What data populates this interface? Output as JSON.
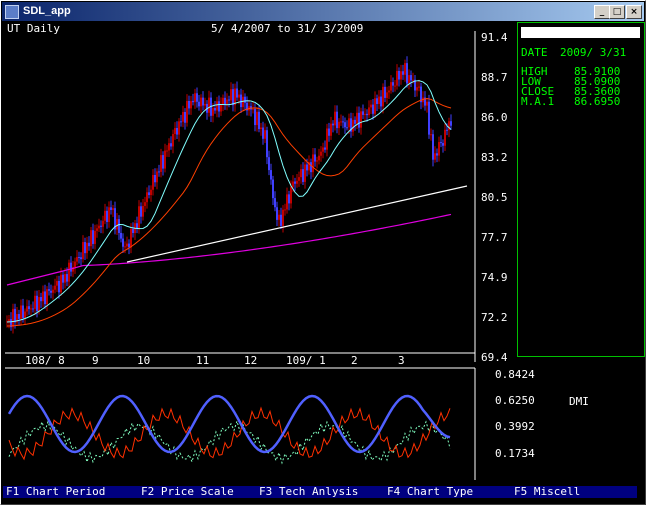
{
  "window": {
    "title": "SDL_app",
    "minimize_label": "_",
    "maximize_label": "□",
    "close_label": "×"
  },
  "chart_header": {
    "left": "UT Daily",
    "period": "5/ 4/2007 to 31/ 3/2009"
  },
  "price_axis": [
    "91.4",
    "88.7",
    "86.0",
    "83.2",
    "80.5",
    "77.7",
    "74.9",
    "72.2",
    "69.4"
  ],
  "date_axis": [
    "108/ 8",
    "9",
    "10",
    "11",
    "12",
    "109/ 1",
    "2",
    "3"
  ],
  "info_panel": {
    "date_label": "DATE",
    "date_value": "2009/ 3/31",
    "rows": [
      {
        "label": "HIGH",
        "value": "85.9100"
      },
      {
        "label": "LOW",
        "value": "85.0900"
      },
      {
        "label": "CLOSE",
        "value": "85.3600"
      },
      {
        "label": "M.A.1",
        "value": "86.6950"
      }
    ]
  },
  "indicator": {
    "name": "DMI",
    "axis": [
      "0.8424",
      "0.6250",
      "0.3992",
      "0.1734"
    ]
  },
  "function_keys": [
    {
      "label": "F1 Chart Period"
    },
    {
      "label": "F2 Price Scale"
    },
    {
      "label": "F3 Tech Anlysis"
    },
    {
      "label": "F4 Chart Type"
    },
    {
      "label": "F5 Miscell"
    }
  ],
  "colors": {
    "up_candle": "#c00000",
    "down_candle": "#4040ff",
    "ma_short": "#80ffff",
    "ma_mid": "#ff4000",
    "ma_long": "#e000e0",
    "trendline": "#ffffff",
    "dmi_plus": "#5060ff",
    "dmi_minus": "#ff3000",
    "adx": "#80ffc0"
  }
}
